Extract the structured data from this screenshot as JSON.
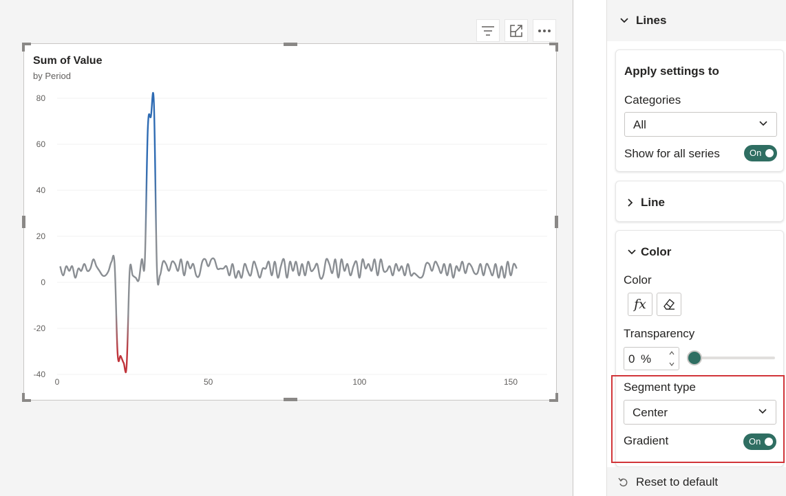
{
  "visual_header": {
    "filter_icon": "filter-icon",
    "focus_icon": "focus-mode-icon",
    "more_icon": "more-options-icon"
  },
  "chart_data": {
    "type": "line",
    "title": "Sum of Value",
    "subtitle": "by Period",
    "xlim": [
      0,
      150
    ],
    "ylim": [
      -40,
      80
    ],
    "x_ticks": [
      "0",
      "50",
      "100",
      "150"
    ],
    "y_ticks": [
      "80",
      "60",
      "40",
      "20",
      "0",
      "-20",
      "-40"
    ],
    "gradient": {
      "high": "#2e6bb3",
      "mid": "#8a8e93",
      "low": "#c0343b"
    },
    "series": [
      {
        "values": [
          7,
          3,
          7,
          5,
          7,
          2,
          6,
          5,
          8,
          5,
          6,
          10,
          7,
          5,
          3,
          3,
          5,
          9,
          8,
          -31,
          -32,
          -35,
          -36,
          5,
          3,
          2,
          1,
          10,
          9,
          67,
          72,
          78,
          6,
          3,
          9,
          8,
          5,
          9,
          8,
          5,
          10,
          3,
          9,
          6,
          8,
          3,
          3,
          9,
          10,
          7,
          10,
          10,
          6,
          6,
          6,
          7,
          3,
          8,
          2,
          5,
          2,
          8,
          5,
          3,
          9,
          6,
          2,
          6,
          6,
          9,
          3,
          9,
          2,
          7,
          10,
          2,
          9,
          5,
          9,
          3,
          8,
          3,
          9,
          5,
          6,
          8,
          2,
          3,
          10,
          8,
          4,
          10,
          2,
          10,
          5,
          8,
          3,
          7,
          9,
          2,
          10,
          6,
          8,
          5,
          10,
          3,
          10,
          5,
          5,
          7,
          3,
          8,
          5,
          7,
          3,
          8,
          3,
          4,
          3,
          2,
          3,
          8,
          8,
          5,
          9,
          7,
          4,
          8,
          3,
          8,
          2,
          7,
          5,
          9,
          4,
          8,
          7,
          4,
          4,
          8,
          3,
          8,
          6,
          3,
          8,
          2,
          7,
          2,
          9,
          3,
          8,
          6
        ]
      }
    ]
  },
  "pane": {
    "section_title": "Lines",
    "apply_title": "Apply settings to",
    "categories_label": "Categories",
    "categories_value": "All",
    "show_all_label": "Show for all series",
    "toggle_on": "On",
    "line_title": "Line",
    "color_title": "Color",
    "color_label": "Color",
    "fx_icon": "fx-icon",
    "eraser_icon": "eraser-icon",
    "transparency_label": "Transparency",
    "transparency_value": "0",
    "transparency_unit": "%",
    "transparency_level": 0,
    "segment_label": "Segment type",
    "segment_value": "Center",
    "gradient_label": "Gradient",
    "reset_label": "Reset to default",
    "accent": "#2f6e62",
    "highlight_color": "#d13438"
  }
}
